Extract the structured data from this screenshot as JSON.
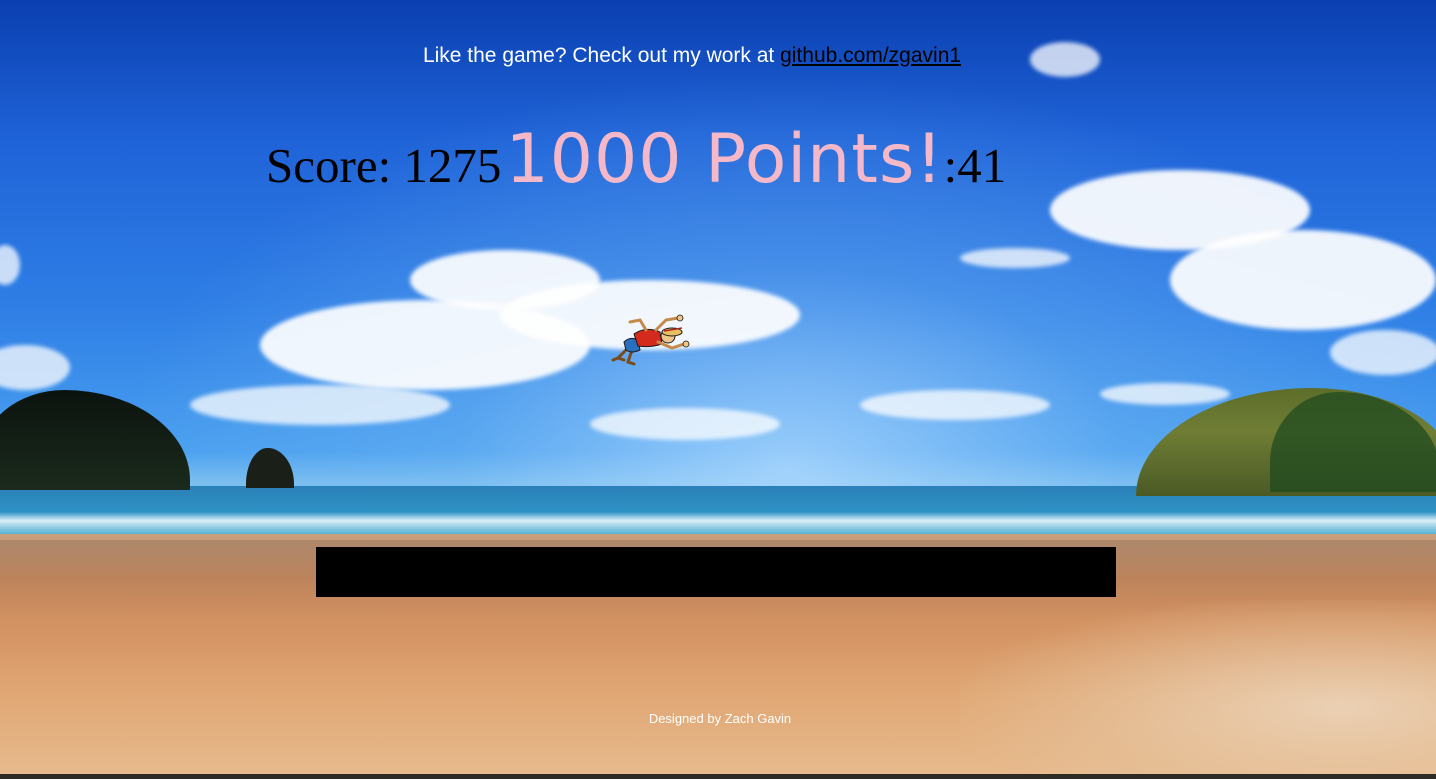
{
  "promo": {
    "text": "Like the game? Check out my work at ",
    "link_text": "github.com/zgavin1"
  },
  "hud": {
    "score_label": "Score: 1275",
    "bonus_text": "1000 Points!",
    "timer": ":41"
  },
  "player": {
    "icon": "running-character-icon"
  },
  "footer": {
    "credit": "Designed by Zach Gavin"
  },
  "colors": {
    "bonus_text": "#f4b8c8",
    "platform": "#000000",
    "promo_text": "#ffffff"
  }
}
